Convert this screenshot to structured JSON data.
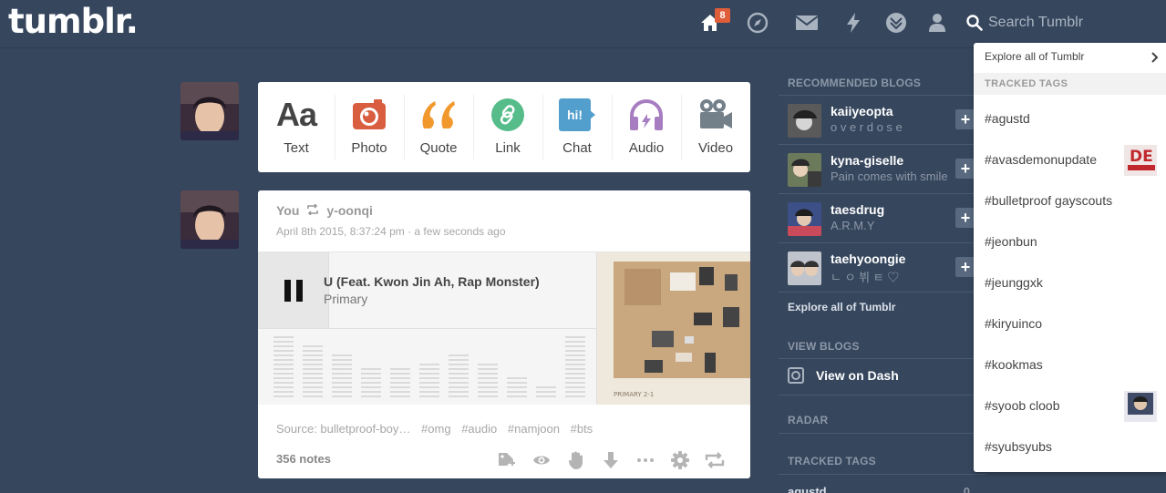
{
  "header": {
    "logo": "tumblr.",
    "inbox_badge": "8",
    "search_placeholder": "Search Tumblr"
  },
  "post_form": {
    "items": [
      {
        "label": "Text",
        "icon": "text-icon"
      },
      {
        "label": "Photo",
        "icon": "camera-icon"
      },
      {
        "label": "Quote",
        "icon": "quote-icon"
      },
      {
        "label": "Link",
        "icon": "link-icon"
      },
      {
        "label": "Chat",
        "icon": "chat-icon"
      },
      {
        "label": "Audio",
        "icon": "headphones-icon"
      },
      {
        "label": "Video",
        "icon": "video-camera-icon"
      }
    ],
    "chat_icon_text": "hi!",
    "text_icon_text": "Aa"
  },
  "post": {
    "author": "You",
    "reblogged_from": "y-oonqi",
    "date": "April 8th 2015, 8:37:24 pm · a few seconds ago",
    "track_title": "U (Feat. Kwon Jin Ah, Rap Monster)",
    "track_artist": "Primary",
    "album_text": "PRIMARY 2-1",
    "source": "Source: bulletproof-boy…",
    "tags": [
      "#omg",
      "#audio",
      "#namjoon",
      "#bts"
    ],
    "notes": "356 notes"
  },
  "sidebar": {
    "recommended_heading": "RECOMMENDED BLOGS",
    "blogs": [
      {
        "name": "kaiiyeopta",
        "subtitle": "o v e r d o s e"
      },
      {
        "name": "kyna-giselle",
        "subtitle": "Pain comes with smile"
      },
      {
        "name": "taesdrug",
        "subtitle": "A.R.M.Y"
      },
      {
        "name": "taehyoongie",
        "subtitle": "ㄴ ㅇ 뷔 ㅌ ♡"
      }
    ],
    "explore_link": "Explore all of Tumblr",
    "view_blogs_heading": "VIEW BLOGS",
    "view_on_dash": "View on Dash",
    "radar_heading": "RADAR",
    "tracked_heading": "TRACKED TAGS",
    "tracked_first": "agustd",
    "tracked_first_count": "0"
  },
  "dropdown": {
    "explore": "Explore all of Tumblr",
    "header": "TRACKED TAGS",
    "tags": [
      "#agustd",
      "#avasdemonupdate",
      "#bulletproof gayscouts",
      "#jeonbun",
      "#jeunggxk",
      "#kiryuinco",
      "#kookmas",
      "#syoob cloob",
      "#syubsyubs"
    ],
    "thumb_text": "DE"
  },
  "colors": {
    "background": "#36465d",
    "badge": "#e05d39",
    "photo": "#d95e40",
    "quote": "#f2992e",
    "link": "#56bc8a",
    "chat": "#529ecc",
    "audio": "#a77dc2",
    "video": "#748089"
  }
}
